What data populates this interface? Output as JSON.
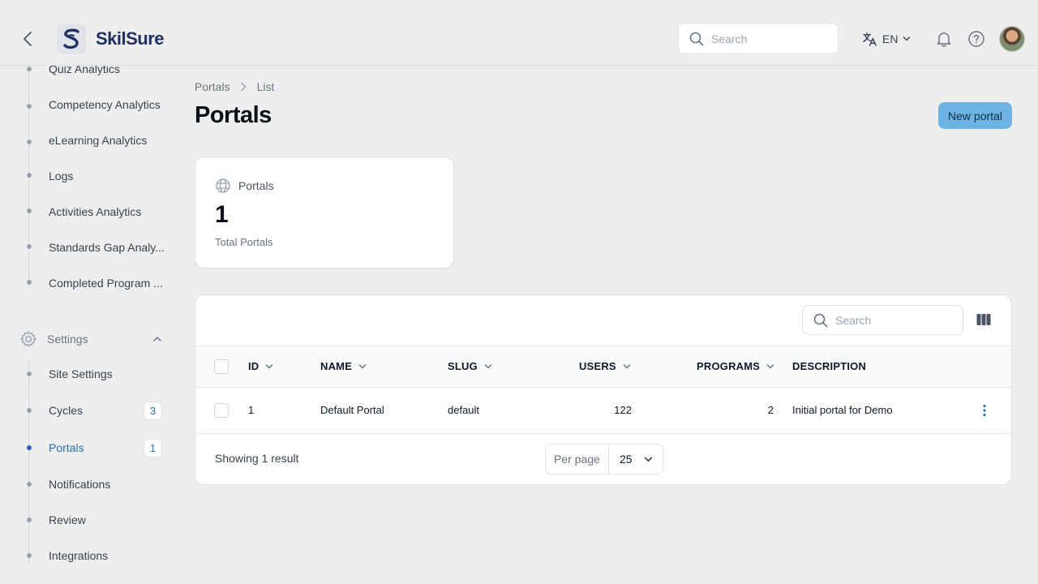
{
  "brand": {
    "name": "SkilSure"
  },
  "header": {
    "search_placeholder": "Search",
    "language": "EN"
  },
  "sidebar": {
    "items_top": [
      {
        "label": "Quiz Analytics"
      },
      {
        "label": "Competency Analytics"
      },
      {
        "label": "eLearning Analytics"
      },
      {
        "label": "Logs"
      },
      {
        "label": "Activities Analytics"
      },
      {
        "label": "Standards Gap Analy..."
      },
      {
        "label": "Completed Program ..."
      }
    ],
    "settings_group": {
      "label": "Settings"
    },
    "items_settings": [
      {
        "label": "Site Settings"
      },
      {
        "label": "Cycles",
        "badge": "3"
      },
      {
        "label": "Portals",
        "badge": "1",
        "active": true
      },
      {
        "label": "Notifications"
      },
      {
        "label": "Review"
      },
      {
        "label": "Integrations"
      }
    ]
  },
  "breadcrumb": {
    "items": [
      "Portals",
      "List"
    ]
  },
  "page": {
    "title": "Portals",
    "new_button": "New portal"
  },
  "stat": {
    "label": "Portals",
    "value": "1",
    "description": "Total Portals"
  },
  "table": {
    "search_placeholder": "Search",
    "columns": [
      "ID",
      "NAME",
      "SLUG",
      "USERS",
      "PROGRAMS",
      "DESCRIPTION"
    ],
    "rows": [
      {
        "id": "1",
        "name": "Default Portal",
        "slug": "default",
        "users": "122",
        "programs": "2",
        "description": "Initial portal for Demo"
      }
    ],
    "footer": {
      "summary": "Showing 1 result",
      "per_page_label": "Per page",
      "per_page_value": "25"
    }
  },
  "colors": {
    "accent": "#6cb4e4",
    "active_link": "#2a6fb0",
    "brand_text": "#1f3161"
  }
}
